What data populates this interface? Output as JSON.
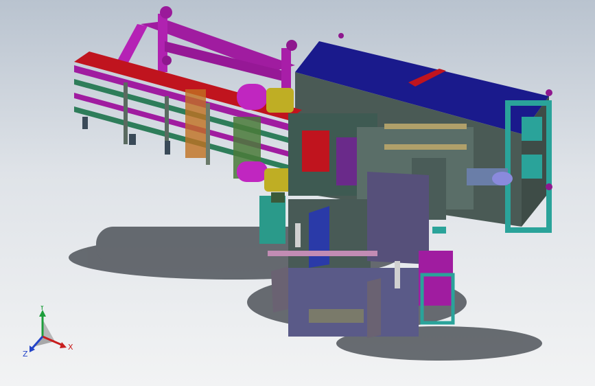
{
  "triad": {
    "x_label": "X",
    "y_label": "Y",
    "z_label": "Z",
    "x_color": "#c81e1e",
    "y_color": "#1e9e3c",
    "z_color": "#2344c8"
  },
  "colors": {
    "background_top": "#b9c3cf",
    "background_bottom": "#f2f3f4",
    "frame_magenta": "#a01ca0",
    "panel_navy": "#1a1a8c",
    "panel_teal": "#2aa39a",
    "housing_grey": "#4a5a55",
    "motor_yellow": "#bfae24",
    "accent_red": "#c0141e",
    "plate_purple": "#56507a"
  },
  "icons": {
    "triad": "xyz-axis-triad-icon"
  }
}
